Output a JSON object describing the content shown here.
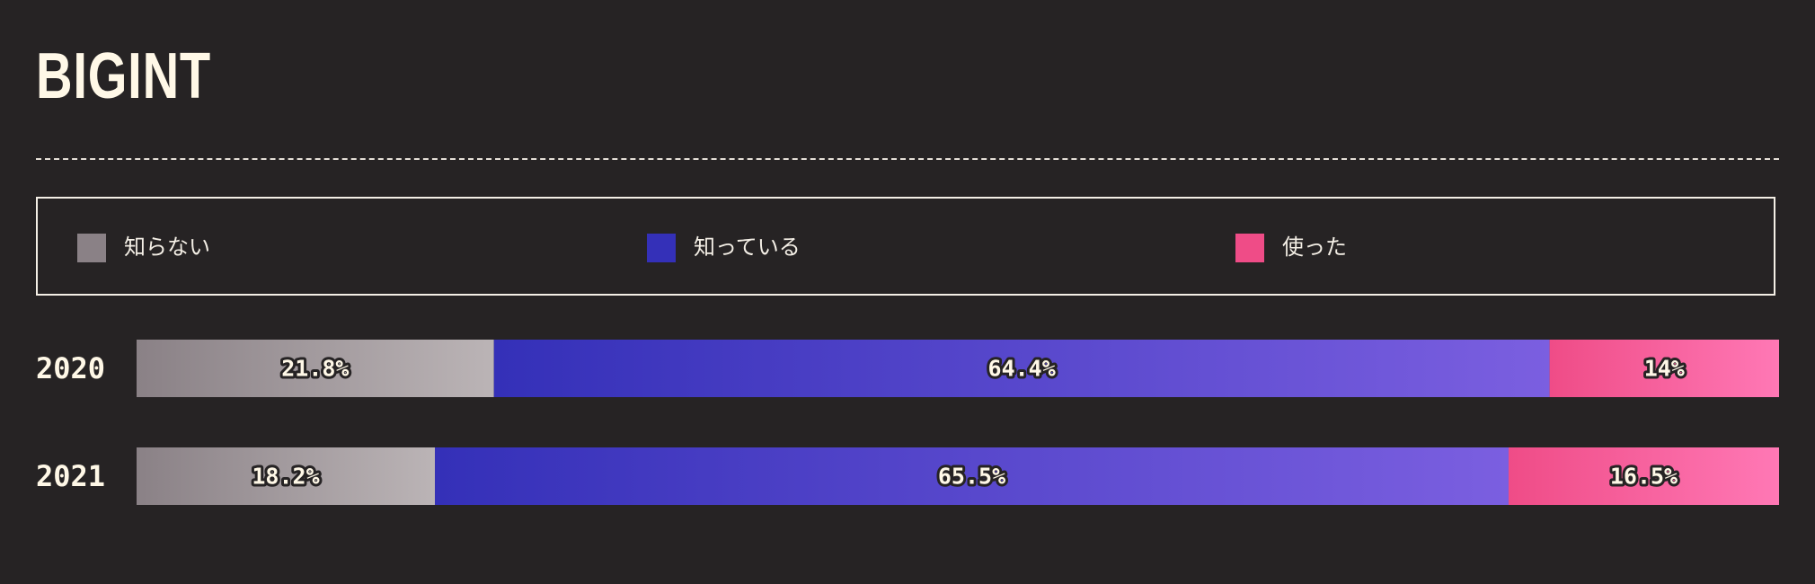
{
  "title": "BIGINT",
  "colors": {
    "background": "#262324",
    "text": "#fff8e7",
    "unknown": [
      "#8a8186",
      "#bbb4b6"
    ],
    "known": [
      "#3430b8",
      "#7b5fe0"
    ],
    "used": [
      "#ef4c87",
      "#ff78b5"
    ]
  },
  "legend": [
    {
      "label": "知らない",
      "color": "#8a8186"
    },
    {
      "label": "知っている",
      "color": "#3430b8"
    },
    {
      "label": "使った",
      "color": "#ef4c87"
    }
  ],
  "chart_data": {
    "type": "bar",
    "orientation": "horizontal",
    "stacked": true,
    "normalized": true,
    "categories": [
      "2020",
      "2021"
    ],
    "series": [
      {
        "name": "知らない",
        "values": [
          21.8,
          18.2
        ],
        "labels": [
          "21.8%",
          "18.2%"
        ]
      },
      {
        "name": "知っている",
        "values": [
          64.4,
          65.5
        ],
        "labels": [
          "64.4%",
          "65.5%"
        ]
      },
      {
        "name": "使った",
        "values": [
          14,
          16.5
        ],
        "labels": [
          "14%",
          "16.5%"
        ]
      }
    ],
    "title": "BIGINT",
    "legend_position": "top",
    "grid": false
  }
}
